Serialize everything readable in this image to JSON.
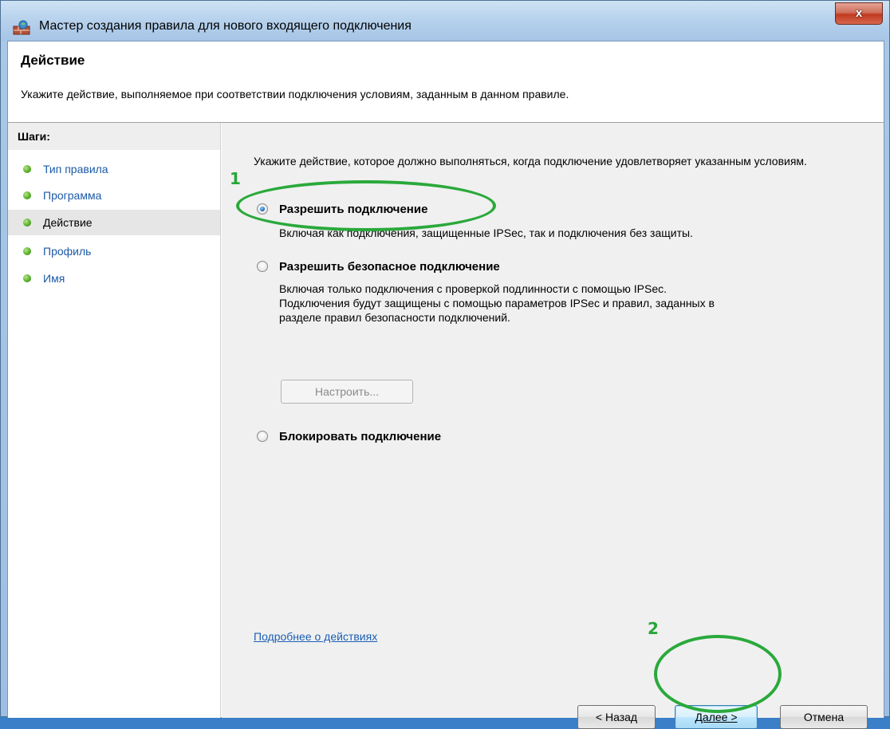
{
  "window": {
    "title": "Мастер создания правила для нового входящего подключения",
    "close_label": "x"
  },
  "header": {
    "title": "Действие",
    "description": "Укажите действие, выполняемое при соответствии подключения условиям, заданным в данном правиле."
  },
  "steps": {
    "title": "Шаги:",
    "items": [
      {
        "label": "Тип правила"
      },
      {
        "label": "Программа"
      },
      {
        "label": "Действие"
      },
      {
        "label": "Профиль"
      },
      {
        "label": "Имя"
      }
    ]
  },
  "main": {
    "intro": "Укажите действие, которое должно выполняться, когда подключение удовлетворяет указанным условиям.",
    "options": [
      {
        "label": "Разрешить подключение",
        "checked": true,
        "desc": [
          "Включая как подключения, защищенные IPSec, так и подключения без защиты."
        ]
      },
      {
        "label": "Разрешить безопасное подключение",
        "checked": false,
        "desc": [
          "Включая только подключения с проверкой подлинности с помощью IPSec.",
          "Подключения будут защищены с помощью параметров IPSec и правил, заданных в",
          "разделе правил безопасности подключений."
        ]
      },
      {
        "label": "Блокировать подключение",
        "checked": false,
        "desc": []
      }
    ],
    "configure_button": "Настроить...",
    "help_link": "Подробнее о действиях"
  },
  "buttons": {
    "back": "< Назад",
    "next": "Далее >",
    "cancel": "Отмена"
  },
  "annotations": {
    "marker1": "1",
    "marker2": "2",
    "color": "#2aa93b"
  }
}
